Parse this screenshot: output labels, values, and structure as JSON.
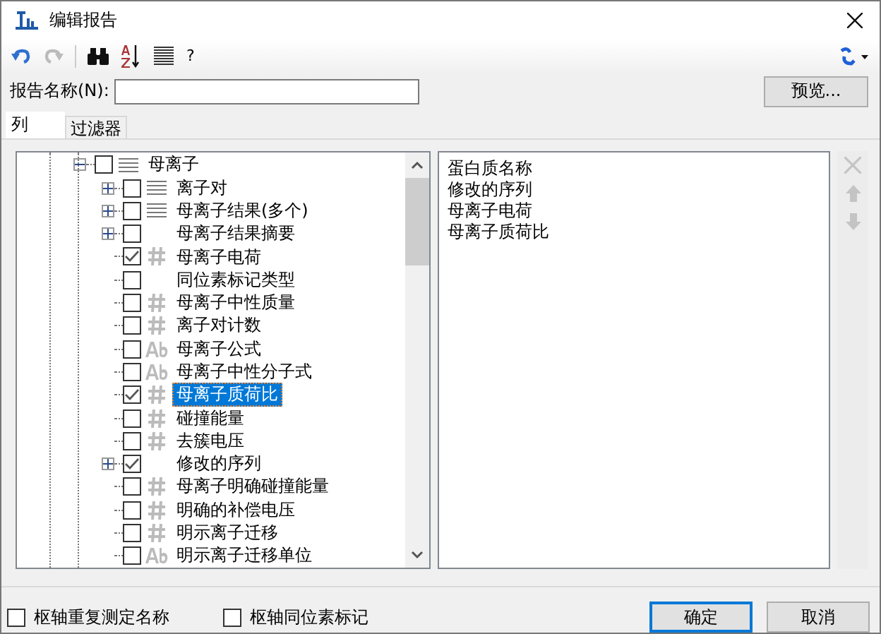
{
  "window": {
    "title": "编辑报告"
  },
  "toolbar": {
    "help": "?"
  },
  "report_name": {
    "label": "报告名称(N):"
  },
  "preview_button": "预览...",
  "tabs": [
    {
      "label": "列",
      "selected": true
    },
    {
      "label": "过滤器",
      "selected": false
    }
  ],
  "tree": {
    "label": "母离子",
    "kind": "list",
    "checked": false,
    "expanded": true,
    "selected": false,
    "children": [
      {
        "label": "离子对",
        "kind": "list",
        "checked": false,
        "expanded": false,
        "selected": false
      },
      {
        "label": "母离子结果(多个)",
        "kind": "list",
        "checked": false,
        "expanded": false,
        "selected": false
      },
      {
        "label": "母离子结果摘要",
        "kind": "none",
        "checked": false,
        "expanded": false,
        "selected": false
      },
      {
        "label": "母离子电荷",
        "kind": "number",
        "checked": true,
        "selected": false
      },
      {
        "label": "同位素标记类型",
        "kind": "none",
        "checked": false,
        "selected": false
      },
      {
        "label": "母离子中性质量",
        "kind": "number",
        "checked": false,
        "selected": false
      },
      {
        "label": "离子对计数",
        "kind": "number",
        "checked": false,
        "selected": false
      },
      {
        "label": "母离子公式",
        "kind": "text",
        "checked": false,
        "selected": false
      },
      {
        "label": "母离子中性分子式",
        "kind": "text",
        "checked": false,
        "selected": false
      },
      {
        "label": "母离子质荷比",
        "kind": "number",
        "checked": true,
        "selected": true
      },
      {
        "label": "碰撞能量",
        "kind": "number",
        "checked": false,
        "selected": false
      },
      {
        "label": "去簇电压",
        "kind": "number",
        "checked": false,
        "selected": false
      },
      {
        "label": "修改的序列",
        "kind": "none",
        "checked": true,
        "expanded": false,
        "selected": false
      },
      {
        "label": "母离子明确碰撞能量",
        "kind": "number",
        "checked": false,
        "selected": false
      },
      {
        "label": "明确的补偿电压",
        "kind": "number",
        "checked": false,
        "selected": false
      },
      {
        "label": "明示离子迁移",
        "kind": "number",
        "checked": false,
        "selected": false
      },
      {
        "label": "明示离子迁移单位",
        "kind": "text",
        "checked": false,
        "selected": false
      }
    ]
  },
  "selected_columns": [
    "蛋白质名称",
    "修改的序列",
    "母离子电荷",
    "母离子质荷比"
  ],
  "options": [
    {
      "label": "枢轴重复测定名称",
      "checked": false
    },
    {
      "label": "枢轴同位素标记",
      "checked": false
    }
  ],
  "buttons": [
    {
      "label": "确定",
      "default": true
    },
    {
      "label": "取消",
      "default": false
    }
  ]
}
